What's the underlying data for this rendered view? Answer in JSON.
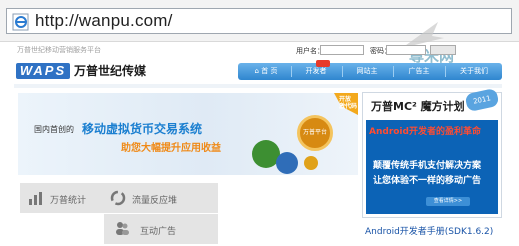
{
  "browser": {
    "url": "http://wanpu.com/"
  },
  "header": {
    "slogan": "万普世纪移动营销服务平台",
    "username_label": "用户名：",
    "password_label": "密码：",
    "logo_mark": "WAPS",
    "logo_text": "万普世纪传媒"
  },
  "nav": {
    "items": [
      {
        "label": "首 页",
        "icon": "home-icon"
      },
      {
        "label": "开发者"
      },
      {
        "label": "网站主"
      },
      {
        "label": "广告主"
      },
      {
        "label": "关于我们"
      }
    ]
  },
  "banner": {
    "left_text": "国内首创的",
    "title": "移动虚拟货币交易系统",
    "subtitle": "助您大幅提升应用收益",
    "ring_label": "万普平台",
    "ribbon": "开放\n激代码"
  },
  "stats": [
    {
      "label": "万普统计",
      "icon": "chart-icon"
    },
    {
      "label": "流量反应堆",
      "icon": "refresh-icon"
    },
    {
      "label": "互动广告",
      "icon": "users-icon"
    }
  ],
  "promo": {
    "title": "万普MC² 魔方计划",
    "badge": "2011",
    "highlight": "Android开发者的盈利革命",
    "line1": "颠覆传统手机支付解决方案",
    "line2": "让您体验不一样的移动广告",
    "button": "查看详情>>",
    "link": "Android开发者手册(SDK1.6.2)"
  },
  "watermark": {
    "text": "尊米网"
  },
  "colors": {
    "nav_blue": "#2f86cf",
    "accent_orange": "#f08a17",
    "promo_blue": "#0c63b6"
  }
}
